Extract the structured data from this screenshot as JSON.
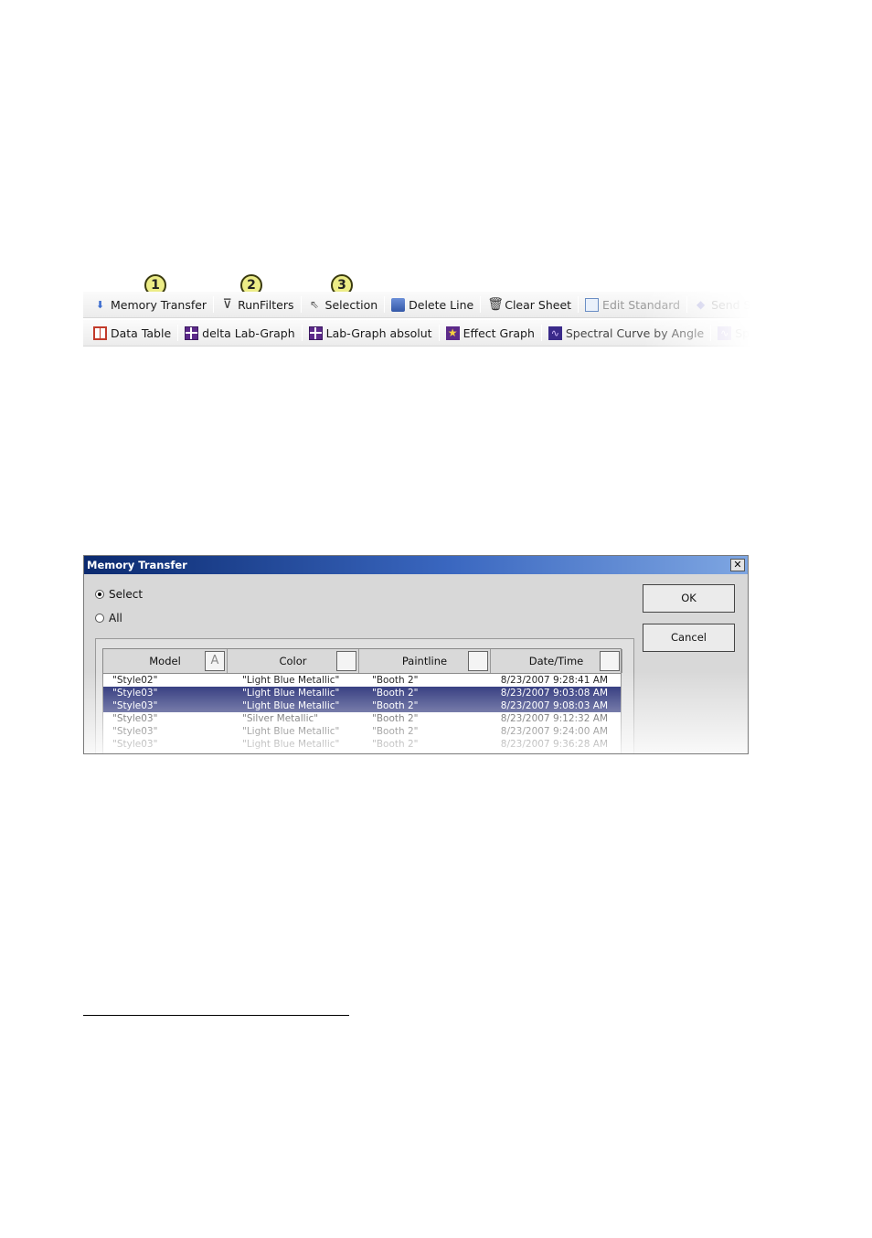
{
  "callouts": [
    "1",
    "2",
    "3"
  ],
  "toolbar_row1": [
    {
      "label": "Memory Transfer",
      "icon": "down-arrow-icon"
    },
    {
      "label": "RunFilters",
      "icon": "filter-icon"
    },
    {
      "label": "Selection",
      "icon": "pointer-icon"
    },
    {
      "label": "Delete Line",
      "icon": "delete-line-icon"
    },
    {
      "label": "Clear Sheet",
      "icon": "trash-icon"
    },
    {
      "label": "Edit Standard",
      "icon": "edit-icon"
    },
    {
      "label": "Send Sh",
      "icon": "send-icon"
    }
  ],
  "toolbar_row2": [
    {
      "label": "Data Table",
      "icon": "table-icon"
    },
    {
      "label": "delta Lab-Graph",
      "icon": "grid-icon"
    },
    {
      "label": "Lab-Graph absolut",
      "icon": "grid-icon"
    },
    {
      "label": "Effect Graph",
      "icon": "star-icon"
    },
    {
      "label": "Spectral Curve by Angle",
      "icon": "spectral-icon"
    },
    {
      "label": "Spectr",
      "icon": "spectral-icon"
    }
  ],
  "dialog": {
    "title": "Memory Transfer",
    "close": "✕",
    "radio_select": "Select",
    "radio_all": "All",
    "ok": "OK",
    "cancel": "Cancel",
    "columns": [
      "Model",
      "Color",
      "Paintline",
      "Date/Time"
    ],
    "rows": [
      {
        "model": "\"Style02\"",
        "color": "\"Light Blue Metallic\"",
        "paintline": "\"Booth 2\"",
        "datetime": "8/23/2007 9:28:41 AM",
        "selected": false
      },
      {
        "model": "\"Style03\"",
        "color": "\"Light Blue Metallic\"",
        "paintline": "\"Booth 2\"",
        "datetime": "8/23/2007 9:03:08 AM",
        "selected": true
      },
      {
        "model": "\"Style03\"",
        "color": "\"Light Blue Metallic\"",
        "paintline": "\"Booth 2\"",
        "datetime": "8/23/2007 9:08:03 AM",
        "selected": true
      },
      {
        "model": "\"Style03\"",
        "color": "\"Silver Metallic\"",
        "paintline": "\"Booth 2\"",
        "datetime": "8/23/2007 9:12:32 AM",
        "selected": false
      },
      {
        "model": "\"Style03\"",
        "color": "\"Light Blue Metallic\"",
        "paintline": "\"Booth 2\"",
        "datetime": "8/23/2007 9:24:00 AM",
        "selected": false
      },
      {
        "model": "\"Style03\"",
        "color": "\"Light Blue Metallic\"",
        "paintline": "\"Booth 2\"",
        "datetime": "8/23/2007 9:36:28 AM",
        "selected": false
      }
    ]
  }
}
